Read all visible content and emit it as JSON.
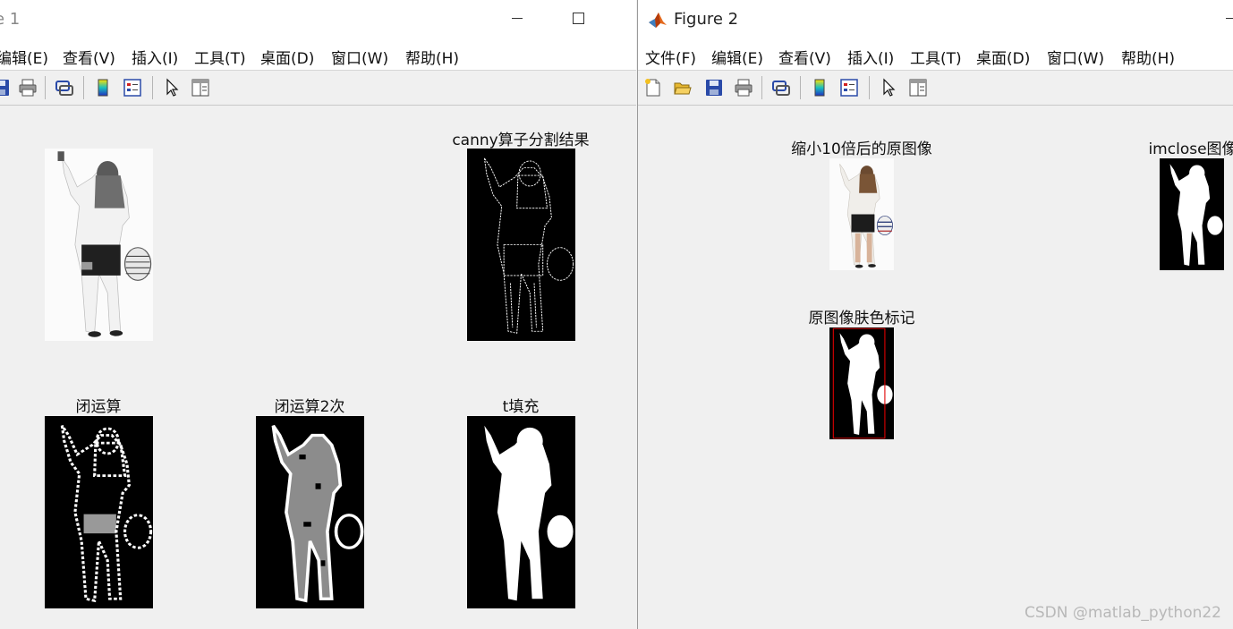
{
  "figure1": {
    "title": "e 1",
    "menu": [
      "编辑(E)",
      "查看(V)",
      "插入(I)",
      "工具(T)",
      "桌面(D)",
      "窗口(W)",
      "帮助(H)"
    ],
    "axes": {
      "original_title": "",
      "canny_title": "canny算子分割结果",
      "close1_title": "闭运算",
      "close2_title": "闭运算2次",
      "fill_title": "t填充"
    }
  },
  "figure2": {
    "title": "Figure 2",
    "menu": [
      "文件(F)",
      "编辑(E)",
      "查看(V)",
      "插入(I)",
      "工具(T)",
      "桌面(D)",
      "窗口(W)",
      "帮助(H)"
    ],
    "axes": {
      "shrunk_title": "缩小10倍后的原图像",
      "imclose_title": "imclose图像",
      "skin_title": "原图像肤色标记"
    }
  },
  "watermark": "CSDN @matlab_python22",
  "icons": [
    "save-icon",
    "print-icon",
    "link-icon",
    "colorbar-icon",
    "legend-icon",
    "pointer-icon",
    "property-editor-icon",
    "new-figure-icon",
    "open-icon"
  ],
  "colors": {
    "titlebar": "#ffffff",
    "menubar": "#ffffff",
    "figure_bg": "#f0f0f0",
    "skin_box": "#e00000"
  }
}
